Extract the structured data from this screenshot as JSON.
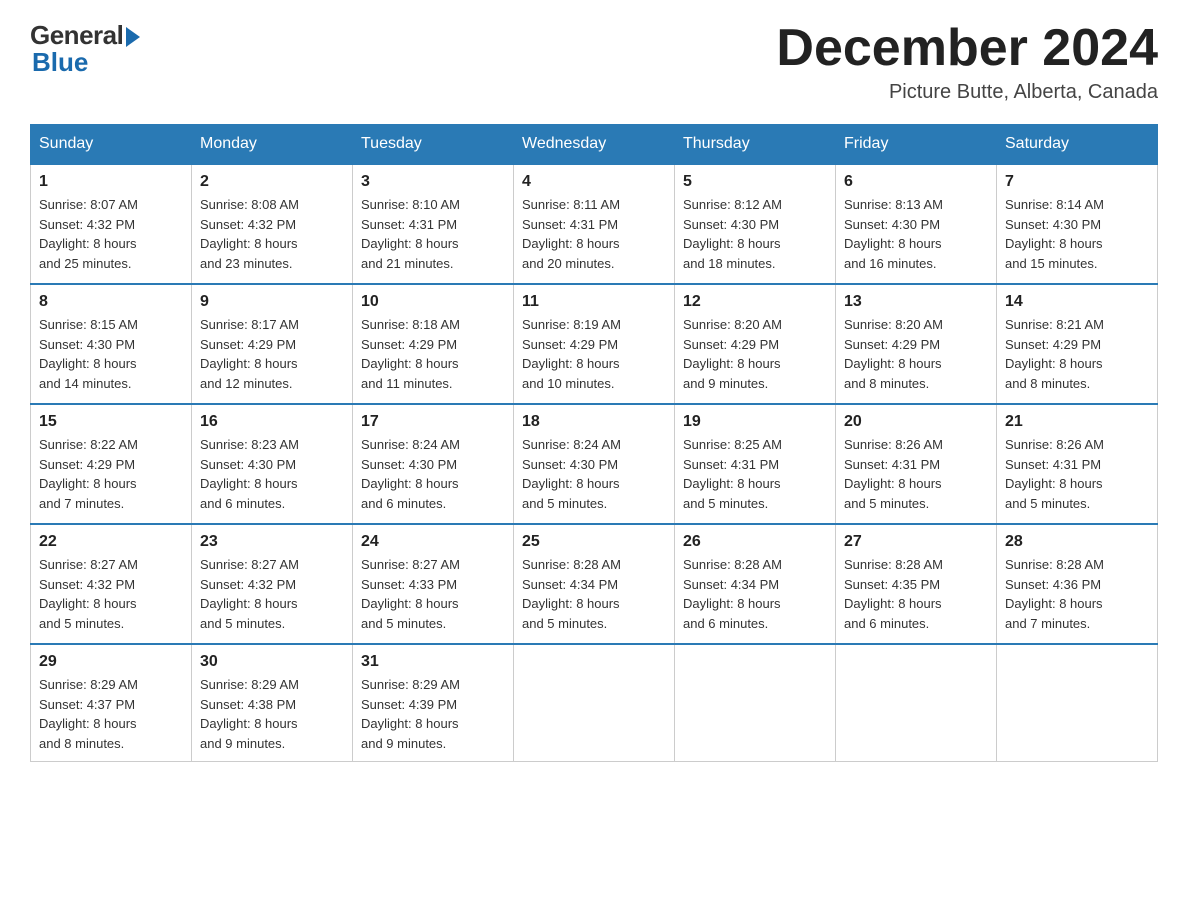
{
  "header": {
    "logo_general": "General",
    "logo_blue": "Blue",
    "month_title": "December 2024",
    "location": "Picture Butte, Alberta, Canada"
  },
  "days_of_week": [
    "Sunday",
    "Monday",
    "Tuesday",
    "Wednesday",
    "Thursday",
    "Friday",
    "Saturday"
  ],
  "weeks": [
    [
      {
        "num": "1",
        "detail": "Sunrise: 8:07 AM\nSunset: 4:32 PM\nDaylight: 8 hours\nand 25 minutes."
      },
      {
        "num": "2",
        "detail": "Sunrise: 8:08 AM\nSunset: 4:32 PM\nDaylight: 8 hours\nand 23 minutes."
      },
      {
        "num": "3",
        "detail": "Sunrise: 8:10 AM\nSunset: 4:31 PM\nDaylight: 8 hours\nand 21 minutes."
      },
      {
        "num": "4",
        "detail": "Sunrise: 8:11 AM\nSunset: 4:31 PM\nDaylight: 8 hours\nand 20 minutes."
      },
      {
        "num": "5",
        "detail": "Sunrise: 8:12 AM\nSunset: 4:30 PM\nDaylight: 8 hours\nand 18 minutes."
      },
      {
        "num": "6",
        "detail": "Sunrise: 8:13 AM\nSunset: 4:30 PM\nDaylight: 8 hours\nand 16 minutes."
      },
      {
        "num": "7",
        "detail": "Sunrise: 8:14 AM\nSunset: 4:30 PM\nDaylight: 8 hours\nand 15 minutes."
      }
    ],
    [
      {
        "num": "8",
        "detail": "Sunrise: 8:15 AM\nSunset: 4:30 PM\nDaylight: 8 hours\nand 14 minutes."
      },
      {
        "num": "9",
        "detail": "Sunrise: 8:17 AM\nSunset: 4:29 PM\nDaylight: 8 hours\nand 12 minutes."
      },
      {
        "num": "10",
        "detail": "Sunrise: 8:18 AM\nSunset: 4:29 PM\nDaylight: 8 hours\nand 11 minutes."
      },
      {
        "num": "11",
        "detail": "Sunrise: 8:19 AM\nSunset: 4:29 PM\nDaylight: 8 hours\nand 10 minutes."
      },
      {
        "num": "12",
        "detail": "Sunrise: 8:20 AM\nSunset: 4:29 PM\nDaylight: 8 hours\nand 9 minutes."
      },
      {
        "num": "13",
        "detail": "Sunrise: 8:20 AM\nSunset: 4:29 PM\nDaylight: 8 hours\nand 8 minutes."
      },
      {
        "num": "14",
        "detail": "Sunrise: 8:21 AM\nSunset: 4:29 PM\nDaylight: 8 hours\nand 8 minutes."
      }
    ],
    [
      {
        "num": "15",
        "detail": "Sunrise: 8:22 AM\nSunset: 4:29 PM\nDaylight: 8 hours\nand 7 minutes."
      },
      {
        "num": "16",
        "detail": "Sunrise: 8:23 AM\nSunset: 4:30 PM\nDaylight: 8 hours\nand 6 minutes."
      },
      {
        "num": "17",
        "detail": "Sunrise: 8:24 AM\nSunset: 4:30 PM\nDaylight: 8 hours\nand 6 minutes."
      },
      {
        "num": "18",
        "detail": "Sunrise: 8:24 AM\nSunset: 4:30 PM\nDaylight: 8 hours\nand 5 minutes."
      },
      {
        "num": "19",
        "detail": "Sunrise: 8:25 AM\nSunset: 4:31 PM\nDaylight: 8 hours\nand 5 minutes."
      },
      {
        "num": "20",
        "detail": "Sunrise: 8:26 AM\nSunset: 4:31 PM\nDaylight: 8 hours\nand 5 minutes."
      },
      {
        "num": "21",
        "detail": "Sunrise: 8:26 AM\nSunset: 4:31 PM\nDaylight: 8 hours\nand 5 minutes."
      }
    ],
    [
      {
        "num": "22",
        "detail": "Sunrise: 8:27 AM\nSunset: 4:32 PM\nDaylight: 8 hours\nand 5 minutes."
      },
      {
        "num": "23",
        "detail": "Sunrise: 8:27 AM\nSunset: 4:32 PM\nDaylight: 8 hours\nand 5 minutes."
      },
      {
        "num": "24",
        "detail": "Sunrise: 8:27 AM\nSunset: 4:33 PM\nDaylight: 8 hours\nand 5 minutes."
      },
      {
        "num": "25",
        "detail": "Sunrise: 8:28 AM\nSunset: 4:34 PM\nDaylight: 8 hours\nand 5 minutes."
      },
      {
        "num": "26",
        "detail": "Sunrise: 8:28 AM\nSunset: 4:34 PM\nDaylight: 8 hours\nand 6 minutes."
      },
      {
        "num": "27",
        "detail": "Sunrise: 8:28 AM\nSunset: 4:35 PM\nDaylight: 8 hours\nand 6 minutes."
      },
      {
        "num": "28",
        "detail": "Sunrise: 8:28 AM\nSunset: 4:36 PM\nDaylight: 8 hours\nand 7 minutes."
      }
    ],
    [
      {
        "num": "29",
        "detail": "Sunrise: 8:29 AM\nSunset: 4:37 PM\nDaylight: 8 hours\nand 8 minutes."
      },
      {
        "num": "30",
        "detail": "Sunrise: 8:29 AM\nSunset: 4:38 PM\nDaylight: 8 hours\nand 9 minutes."
      },
      {
        "num": "31",
        "detail": "Sunrise: 8:29 AM\nSunset: 4:39 PM\nDaylight: 8 hours\nand 9 minutes."
      },
      {
        "num": "",
        "detail": ""
      },
      {
        "num": "",
        "detail": ""
      },
      {
        "num": "",
        "detail": ""
      },
      {
        "num": "",
        "detail": ""
      }
    ]
  ]
}
